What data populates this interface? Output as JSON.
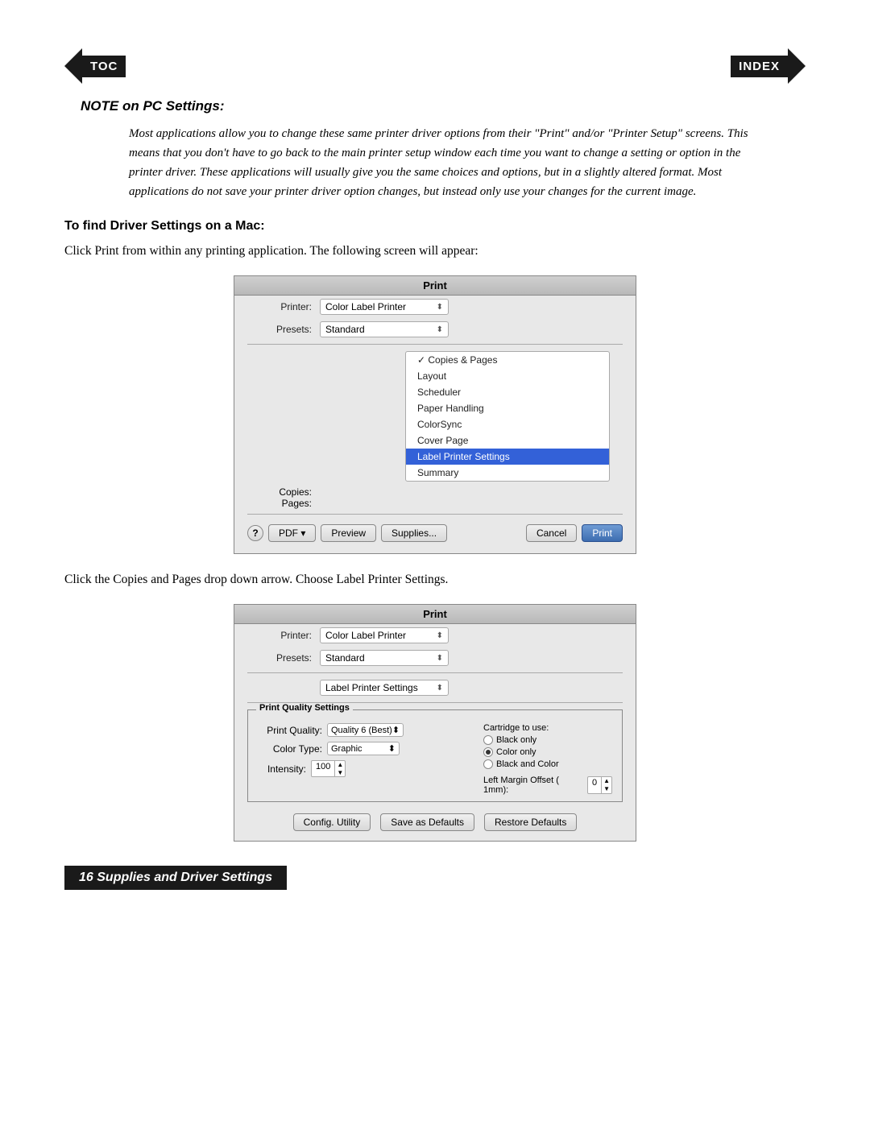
{
  "nav": {
    "toc_label": "TOC",
    "index_label": "INDEX"
  },
  "note": {
    "title": "NOTE on PC Settings:",
    "body": "Most applications allow you to change these same printer driver options from their \"Print\" and/or \"Printer Setup\" screens. This means that you don't have to go back to the main printer setup window each time you want to change a setting or option in the printer driver. These applications will usually give you the same choices and options, but in a slightly altered format. Most applications do not save your printer driver option changes, but instead only use your changes for the current image."
  },
  "section": {
    "heading": "To find Driver Settings on a Mac:",
    "intro_text": "Click Print from within any printing application.  The following screen will appear:"
  },
  "dialog1": {
    "title": "Print",
    "printer_label": "Printer:",
    "printer_value": "Color Label Printer",
    "presets_label": "Presets:",
    "presets_value": "Standard",
    "menu_items": [
      {
        "label": "Copies & Pages",
        "checked": true,
        "highlighted": false
      },
      {
        "label": "Layout",
        "checked": false,
        "highlighted": false
      },
      {
        "label": "Scheduler",
        "checked": false,
        "highlighted": false
      },
      {
        "label": "Paper Handling",
        "checked": false,
        "highlighted": false
      },
      {
        "label": "ColorSync",
        "checked": false,
        "highlighted": false
      },
      {
        "label": "Cover Page",
        "checked": false,
        "highlighted": false
      },
      {
        "label": "Label Printer Settings",
        "checked": false,
        "highlighted": true
      },
      {
        "label": "Summary",
        "checked": false,
        "highlighted": false
      }
    ],
    "copies_label": "Copies:",
    "pages_label": "Pages:",
    "footer_help": "?",
    "footer_pdf": "PDF ▾",
    "footer_preview": "Preview",
    "footer_supplies": "Supplies...",
    "footer_cancel": "Cancel",
    "footer_print": "Print"
  },
  "between_text": "Click the Copies and Pages drop down arrow.  Choose Label Printer Settings.",
  "dialog2": {
    "title_printer_label": "Printer:",
    "title_printer_value": "Color Label Printer",
    "title_presets_label": "Presets:",
    "title_presets_value": "Standard",
    "settings_dropdown_label": "Label Printer Settings",
    "settings_box_title": "Print Quality Settings",
    "print_quality_label": "Print Quality:",
    "print_quality_value": "Quality 6 (Best)",
    "color_type_label": "Color Type:",
    "color_type_value": "Graphic",
    "intensity_label": "Intensity:",
    "intensity_value": "100",
    "cartridge_label": "Cartridge",
    "to_use_label": "to use:",
    "radio_black_only": "Black only",
    "radio_color_only": "Color only",
    "radio_black_color": "Black and Color",
    "margin_label": "Left Margin Offset (",
    "margin_unit": "1mm):",
    "margin_value": "0",
    "btn_config": "Config. Utility",
    "btn_save": "Save as Defaults",
    "btn_restore": "Restore Defaults"
  },
  "footer": {
    "page_label": "16  Supplies and Driver Settings"
  }
}
